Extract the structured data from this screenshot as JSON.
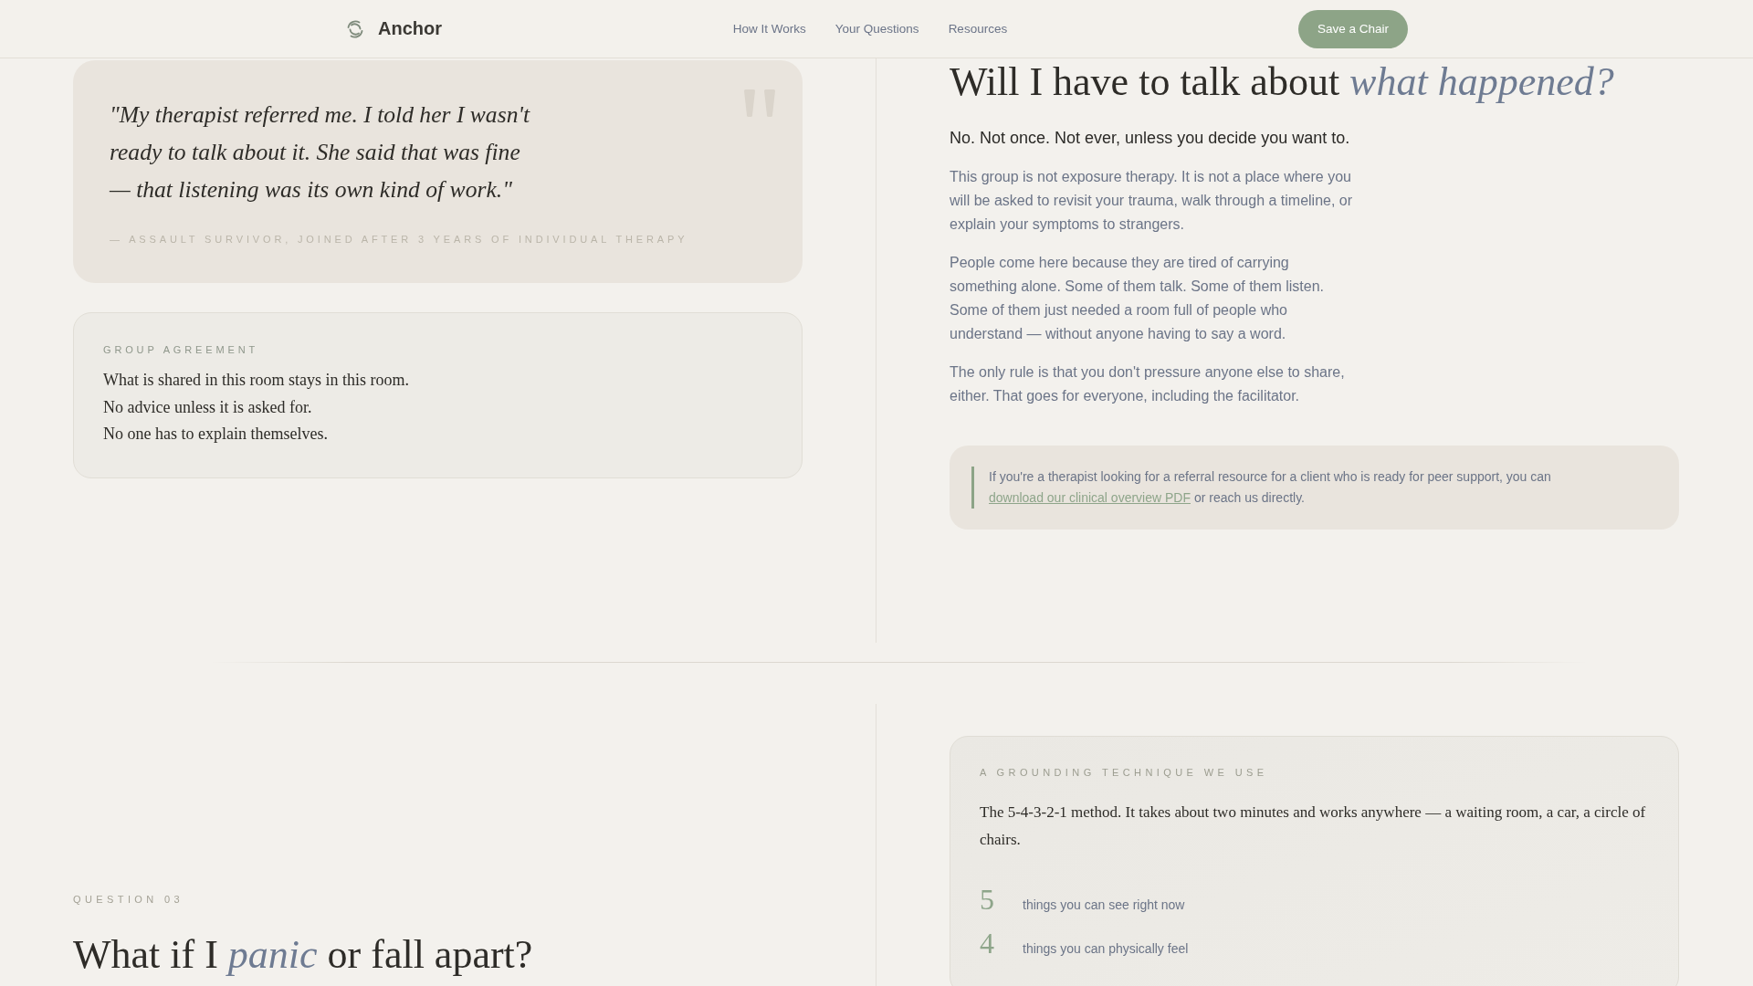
{
  "header": {
    "brand": "Anchor",
    "nav": [
      "How It Works",
      "Your Questions",
      "Resources"
    ],
    "cta": "Save a Chair"
  },
  "testimonial": {
    "quote": "\"My therapist referred me. I told her I wasn't ready to talk about it. She said that was fine — that listening was its own kind of work.\"",
    "attribution": "— ASSAULT SURVIVOR, JOINED AFTER 3 YEARS OF INDIVIDUAL THERAPY"
  },
  "agreement": {
    "label": "GROUP AGREEMENT",
    "items": [
      "What is shared in this room stays in this room.",
      "No advice unless it is asked for.",
      "No one has to explain themselves."
    ]
  },
  "answer": {
    "heading": "Will I have to talk about *what happened?*",
    "lead": "No. Not once. Not ever, unless you decide you want to.",
    "paragraphs": [
      "This group is not exposure therapy. It is not a place where you will be asked to revisit your trauma, walk through a timeline, or explain your symptoms to strangers.",
      "People come here because they are tired of carrying something alone. Some of them talk. Some of them listen. Some of them just needed a room full of people who understand — without anyone having to say a word.",
      "The only rule is that you don't pressure anyone else to share, either. That goes for everyone, including the facilitator."
    ],
    "note": {
      "before": "If you're a therapist looking for a referral resource for a client who is ready for peer support, you can",
      "link": "download our clinical overview PDF",
      "after": "or reach us directly."
    }
  },
  "question": {
    "label": "QUESTION 03",
    "heading": "What if I *panic* or fall apart?"
  },
  "technique": {
    "label": "A GROUNDING TECHNIQUE WE USE",
    "intro": "The 5-4-3-2-1 method. It takes about two minutes and works anywhere — a waiting room, a car, a circle of chairs.",
    "steps": [
      {
        "number": "5",
        "text": "things you can see right now"
      },
      {
        "number": "4",
        "text": "things you can physically feel"
      }
    ]
  }
}
